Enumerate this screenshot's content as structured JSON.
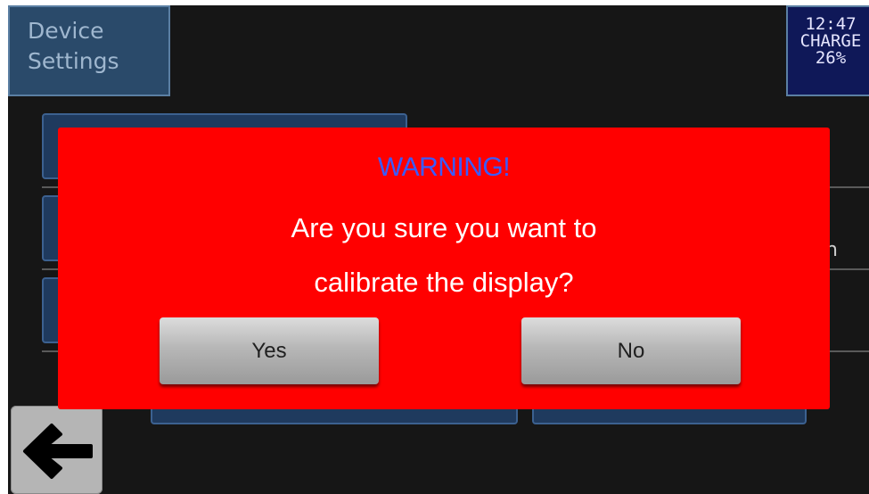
{
  "header": {
    "title_line1": "Device",
    "title_line2": "Settings"
  },
  "status": {
    "time": "12:47",
    "charge_label": "CHARGE",
    "charge_percent": "26%"
  },
  "background": {
    "partial_label": "n"
  },
  "dialog": {
    "title": "WARNING!",
    "message_line1": "Are you sure you want to",
    "message_line2": "calibrate the display?",
    "yes_label": "Yes",
    "no_label": "No"
  },
  "colors": {
    "dialog_background": "#ff0000",
    "warning_title": "#3a5cff",
    "screen_background": "#161616",
    "header_box": "#2a4a6a",
    "status_box": "#0f1858"
  },
  "icons": {
    "back": "left-arrow-icon"
  }
}
